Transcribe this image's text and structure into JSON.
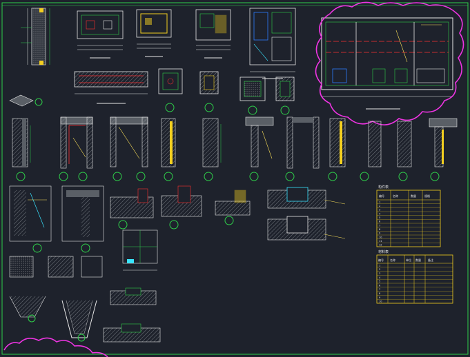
{
  "colors": {
    "background": "#1e222c",
    "linework": "#2fd04a",
    "dimension": "#e8e8e8",
    "hatch": "#b0b0b0",
    "section_fill": "#5a5f66",
    "highlight": "#ee34e2",
    "annotation": "#ffe45a",
    "accent_red": "#ff3030",
    "accent_yellow": "#f4d020",
    "accent_blue": "#2c7cff",
    "accent_cyan": "#39e4ff"
  },
  "tables": {
    "top": {
      "title": "构件表",
      "header": [
        "编号",
        "名称",
        "数量",
        "规格"
      ],
      "rows": [
        [
          "1",
          "",
          "",
          ""
        ],
        [
          "2",
          "",
          "",
          ""
        ],
        [
          "3",
          "",
          "",
          ""
        ],
        [
          "4",
          "",
          "",
          ""
        ],
        [
          "5",
          "",
          "",
          ""
        ],
        [
          "6",
          "",
          "",
          ""
        ],
        [
          "7",
          "",
          "",
          ""
        ],
        [
          "8",
          "",
          "",
          ""
        ],
        [
          "9",
          "",
          "",
          ""
        ],
        [
          "10",
          "",
          "",
          ""
        ],
        [
          "11",
          "",
          "",
          ""
        ],
        [
          "12",
          "",
          "",
          ""
        ]
      ]
    },
    "bottom": {
      "title": "材料表",
      "header": [
        "编号",
        "名称",
        "单位",
        "数量",
        "备注"
      ],
      "rows": [
        [
          "1",
          "",
          "",
          "",
          ""
        ],
        [
          "2",
          "",
          "",
          "",
          ""
        ],
        [
          "3",
          "",
          "",
          "",
          ""
        ],
        [
          "4",
          "",
          "",
          "",
          ""
        ],
        [
          "5",
          "",
          "",
          "",
          ""
        ],
        [
          "6",
          "",
          "",
          "",
          ""
        ],
        [
          "7",
          "",
          "",
          "",
          ""
        ],
        [
          "8",
          "",
          "",
          "",
          ""
        ],
        [
          "9",
          "",
          "",
          "",
          ""
        ],
        [
          "10",
          "",
          "",
          "",
          ""
        ]
      ]
    }
  }
}
